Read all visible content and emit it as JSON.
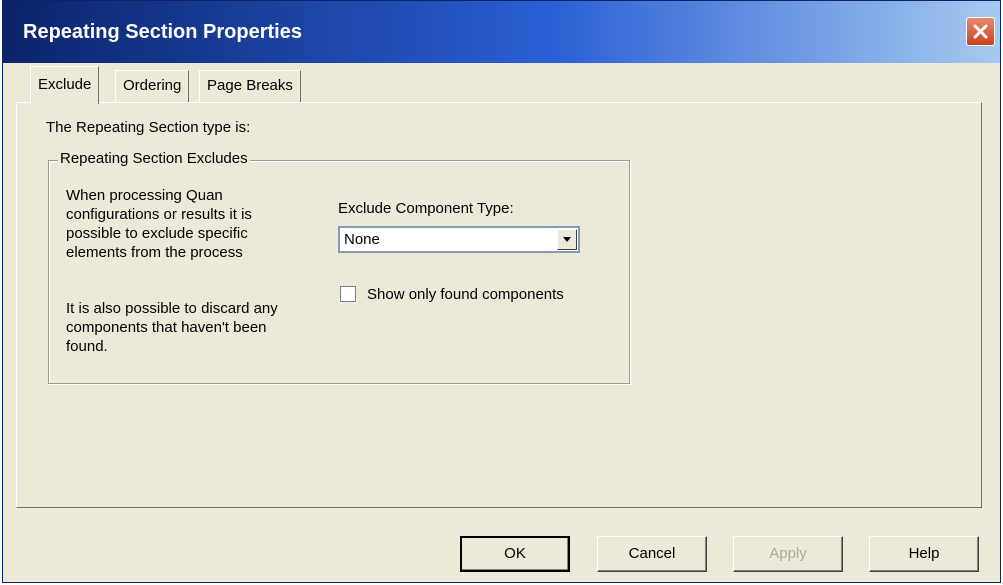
{
  "window": {
    "title": "Repeating Section Properties",
    "close_icon": "close-icon"
  },
  "tabs": [
    {
      "label": "Exclude",
      "active": true
    },
    {
      "label": "Ordering",
      "active": false
    },
    {
      "label": "Page Breaks",
      "active": false
    }
  ],
  "content": {
    "section_type_label": "The Repeating Section type is:",
    "group_title": "Repeating Section Excludes",
    "description_lines": [
      "When processing Quan",
      "configurations or results it is",
      "possible to exclude specific",
      "elements from the process"
    ],
    "discard_lines": [
      "It is also possible to discard any",
      "components that haven't been",
      "found."
    ],
    "exclude_type_label": "Exclude Component Type:",
    "exclude_type_value": "None",
    "show_found_label": "Show only found components",
    "show_found_checked": false
  },
  "buttons": {
    "ok": "OK",
    "cancel": "Cancel",
    "apply": "Apply",
    "help": "Help"
  },
  "colors": {
    "dialog_bg": "#ece9d8",
    "titlebar": "#0a246a",
    "close": "#c8401f"
  }
}
